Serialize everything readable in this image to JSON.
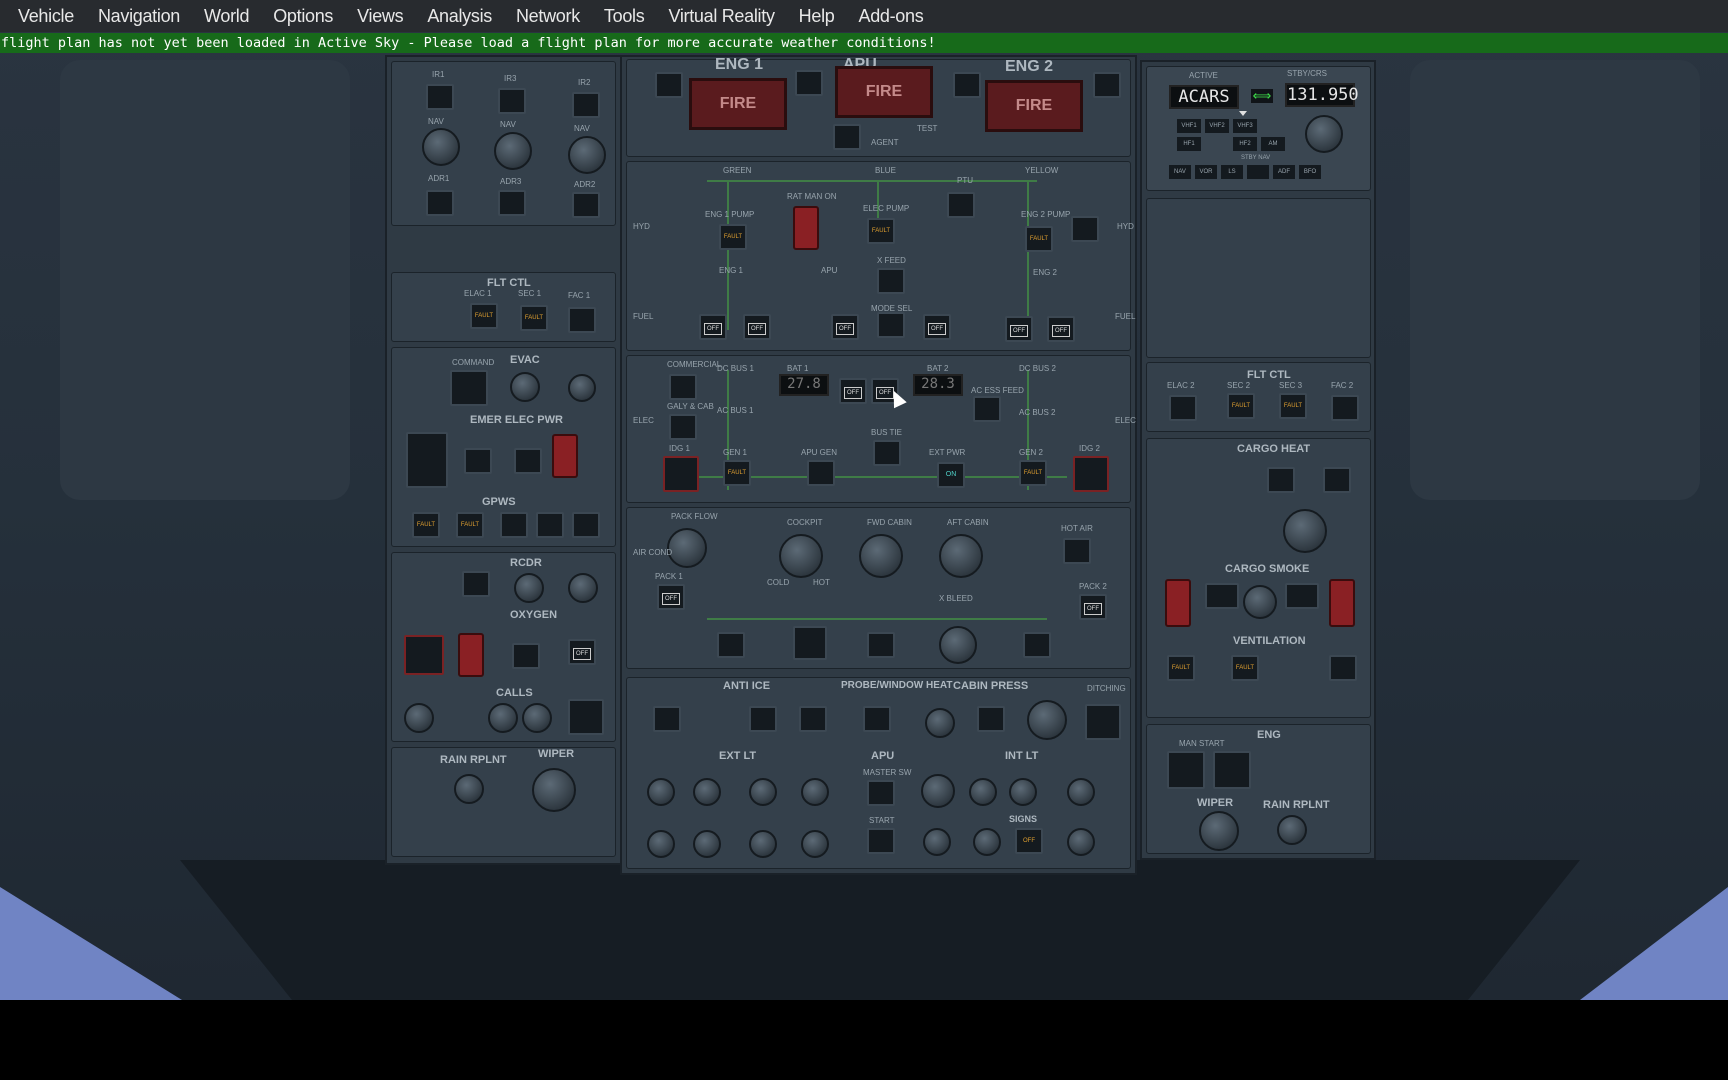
{
  "menubar": {
    "items": [
      "Vehicle",
      "Navigation",
      "World",
      "Options",
      "Views",
      "Analysis",
      "Network",
      "Tools",
      "Virtual Reality",
      "Help",
      "Add-ons"
    ]
  },
  "banner": {
    "text": "flight plan has not yet been loaded in Active Sky - Please load a flight plan for more accurate weather conditions!",
    "color": "#176a1a"
  },
  "overhead": {
    "fire": {
      "eng1": "ENG 1",
      "apu": "APU",
      "eng2": "ENG 2",
      "button": "FIRE",
      "agent": "AGENT",
      "test": "TEST"
    },
    "adirs": [
      "IR1",
      "IR3",
      "IR2",
      "NAV",
      "NAV",
      "NAV",
      "ADR1",
      "ADR3",
      "ADR2"
    ],
    "hyd": {
      "green": "GREEN",
      "blue": "BLUE",
      "yellow": "YELLOW",
      "ptu": "PTU",
      "rat": "RAT MAN ON",
      "elec_pump": "ELEC PUMP",
      "eng1_pump": "ENG 1 PUMP",
      "eng2_pump": "ENG 2 PUMP",
      "side": "HYD"
    },
    "fuel": {
      "eng1": "ENG 1",
      "apu": "APU",
      "eng2": "ENG 2",
      "xfeed": "X FEED",
      "side": "FUEL",
      "mode_sel": "MODE SEL"
    },
    "elec": {
      "commercial": "COMMERCIAL",
      "dc_bus1": "DC BUS 1",
      "dc_bus2": "DC BUS 2",
      "bat1": "BAT 1",
      "bat2": "BAT 2",
      "bat1_volts": "27.8",
      "bat2_volts": "28.3",
      "ac_bus1": "AC BUS 1",
      "ac_bus2": "AC BUS 2",
      "ac_ess_feed": "AC ESS FEED",
      "galy": "GALY & CAB",
      "idg1": "IDG 1",
      "idg2": "IDG 2",
      "gen1": "GEN 1",
      "gen2": "GEN 2",
      "apu_gen": "APU GEN",
      "bus_tie": "BUS TIE",
      "ext_pwr": "EXT PWR",
      "on": "ON",
      "side": "ELEC"
    },
    "aircond": {
      "pack_flow": "PACK FLOW",
      "cockpit": "COCKPIT",
      "fwd_cabin": "FWD CABIN",
      "aft_cabin": "AFT CABIN",
      "hot_air": "HOT AIR",
      "pack1": "PACK 1",
      "pack2": "PACK 2",
      "xbleed": "X BLEED",
      "side": "AIR COND",
      "cold": "COLD",
      "hot": "HOT"
    },
    "left": {
      "flt_ctl": "FLT CTL",
      "elac1": "ELAC 1",
      "sec1": "SEC 1",
      "fac1": "FAC 1",
      "evac": "EVAC",
      "command": "COMMAND",
      "emer_elec": "EMER ELEC PWR",
      "gpws": "GPWS",
      "rcdr": "RCDR",
      "oxygen": "OXYGEN",
      "calls": "CALLS",
      "rain_rplnt": "RAIN RPLNT",
      "wiper": "WIPER"
    },
    "bottom": {
      "anti_ice": "ANTI ICE",
      "probe_heat": "PROBE/WINDOW HEAT",
      "cabin_press": "CABIN PRESS",
      "ext_lt": "EXT LT",
      "apu": "APU",
      "int_lt": "INT LT",
      "signs": "SIGNS",
      "master_sw": "MASTER SW",
      "start": "START",
      "ditching": "DITCHING"
    },
    "right": {
      "active": "ACTIVE",
      "standby": "STBY/CRS",
      "active_freq": "ACARS",
      "standby_freq": "131.950",
      "radio_buttons": [
        "VHF1",
        "VHF2",
        "VHF3",
        "HF1",
        "HF2",
        "AM",
        "NAV",
        "VOR",
        "LS",
        "ADF",
        "BFO"
      ],
      "stby_nav": "STBY NAV",
      "flt_ctl": "FLT CTL",
      "elac2": "ELAC 2",
      "sec2": "SEC 2",
      "sec3": "SEC 3",
      "fac2": "FAC 2",
      "cargo_heat": "CARGO HEAT",
      "cargo_smoke": "CARGO SMOKE",
      "ventilation": "VENTILATION",
      "eng": "ENG",
      "man_start": "MAN START",
      "wiper": "WIPER",
      "rain_rplnt": "RAIN RPLNT"
    },
    "annunciators": {
      "fault": "FAULT",
      "off": "OFF"
    }
  }
}
